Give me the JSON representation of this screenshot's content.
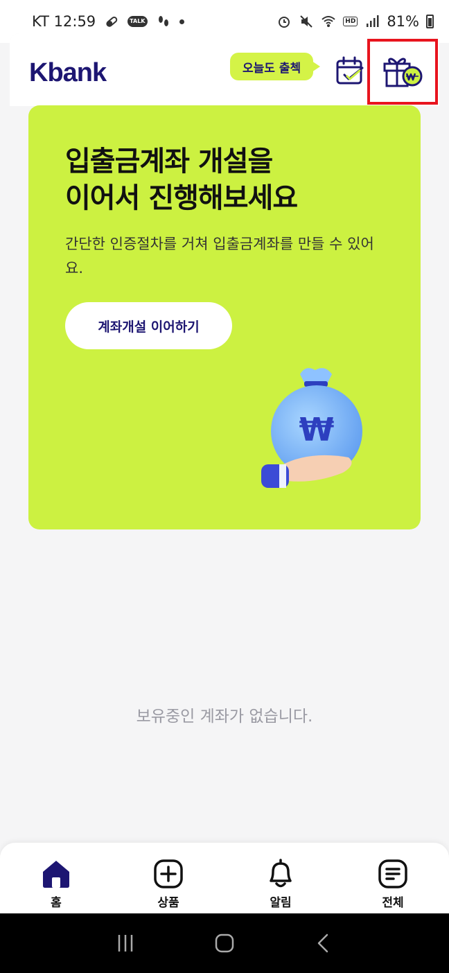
{
  "status_bar": {
    "carrier_time": "KT 12:59",
    "talk_badge": "TALK",
    "hd_badge": "HD",
    "battery": "81%"
  },
  "header": {
    "logo": "Kbank",
    "attendance_bubble": "오늘도 출첵"
  },
  "promo": {
    "title": "입출금계좌 개설을\n이어서 진행해보세요",
    "description": "간단한 인증절차를 거쳐 입출금계좌를 만들 수 있어요.",
    "button_label": "계좌개설 이어하기",
    "money_symbol": "₩"
  },
  "empty_message": "보유중인 계좌가 없습니다.",
  "bottom_nav": {
    "items": [
      {
        "label": "홈",
        "icon": "home-icon"
      },
      {
        "label": "상품",
        "icon": "plus-square-icon"
      },
      {
        "label": "알림",
        "icon": "bell-icon"
      },
      {
        "label": "전체",
        "icon": "menu-list-icon"
      }
    ]
  },
  "colors": {
    "brand_navy": "#1d1672",
    "lime": "#ccf141",
    "highlight_red": "#e8141e"
  }
}
